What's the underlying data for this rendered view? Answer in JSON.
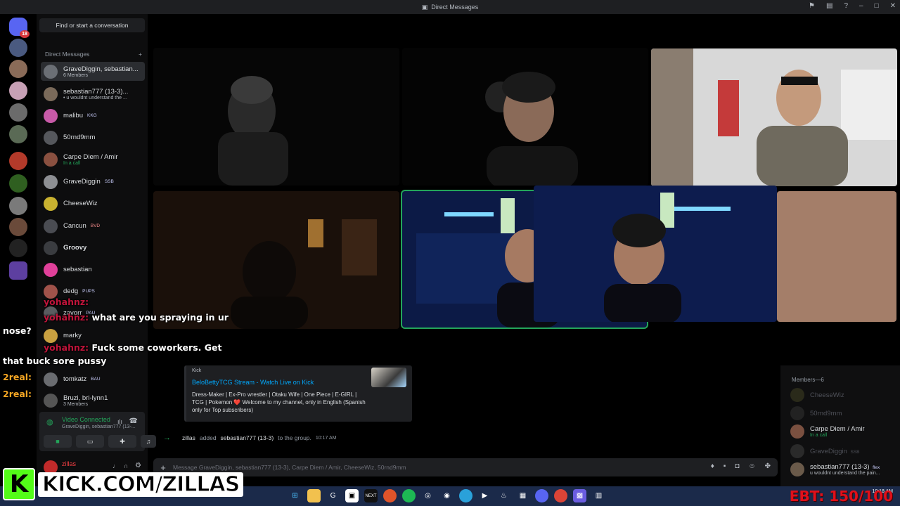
{
  "window": {
    "title": "Direct Messages"
  },
  "rail": {
    "home_badge": "18",
    "dot_badge": "1"
  },
  "sidebar": {
    "search_label": "Find or start a conversation",
    "section_label": "Direct Messages",
    "add_icon": "+",
    "items": [
      {
        "name": "GraveDiggin, sebastian...",
        "sub": "6 Members",
        "tag": ""
      },
      {
        "name": "sebastian777 (13-3)...",
        "sub": "• u wouldnt understand the ...",
        "tag": ""
      },
      {
        "name": "malibu",
        "sub": "",
        "tag": "KKG"
      },
      {
        "name": "50rnd9mm",
        "sub": "",
        "tag": ""
      },
      {
        "name": "Carpe Diem / Amir",
        "sub": "In a call",
        "tag": ""
      },
      {
        "name": "GraveDiggin",
        "sub": "",
        "tag": "SSB"
      },
      {
        "name": "CheeseWiz",
        "sub": "",
        "tag": ""
      },
      {
        "name": "Cancun",
        "sub": "",
        "tag": "BVD"
      },
      {
        "name": "Groovy",
        "sub": "",
        "tag": ""
      },
      {
        "name": "sebastian",
        "sub": "",
        "tag": ""
      },
      {
        "name": "dedg",
        "sub": "",
        "tag": "PUPS"
      },
      {
        "name": "zavorr",
        "sub": "",
        "tag": "PAU"
      },
      {
        "name": "marky",
        "sub": "",
        "tag": ""
      },
      {
        "name": "tomkatz",
        "sub": "",
        "tag": "BAU"
      },
      {
        "name": "Bruzi, bri-lynn1",
        "sub": "3 Members",
        "tag": ""
      }
    ]
  },
  "voice": {
    "status": "Video Connected",
    "channel": "GraveDiggin, sebastian777 (13-..."
  },
  "user_panel": {
    "name": "zillas"
  },
  "overlay": {
    "user1": "yohahnz:",
    "msg1a": "what are you spraying in ur",
    "msg1b": "nose?",
    "user2": "yohahnz:",
    "msg2a": "Fuck some coworkers. Get",
    "msg2b": "that buck sore pussy",
    "tag1": "2real:",
    "tag2": "2real:"
  },
  "embed": {
    "provider": "Kick",
    "title": "BeloBettyTCG Stream - Watch Live on Kick",
    "description": "Dress-Maker | Ex-Pro wrestler | Otaku Wife | One Piece | E-GIRL | TCG | Pokemon ❤️ Welcome to my channel, only in English (Spanish only for Top subscribers)"
  },
  "system_message": {
    "actor": "zillas",
    "action": "added",
    "target": "sebastian777 (13-3)",
    "rest": "to the group.",
    "time": "10:17 AM"
  },
  "composer": {
    "placeholder": "Message GraveDiggin, sebastian777 (13-3), Carpe Diem / Amir, CheeseWiz, 50rnd9mm"
  },
  "members": {
    "header": "Members—6",
    "list": [
      {
        "name": "CheeseWiz",
        "sub": "",
        "dim": true
      },
      {
        "name": "50rnd9mm",
        "sub": "",
        "dim": true
      },
      {
        "name": "Carpe Diem / Amir",
        "sub": "In a call",
        "dim": false
      },
      {
        "name": "GraveDiggin",
        "sub": "",
        "dim": true
      },
      {
        "name": "sebastian777 (13-3)",
        "sub": "u wouldnt understand the pain...",
        "dim": false
      }
    ],
    "flex_tag": "flex",
    "ssb_tag": "SSB"
  },
  "stream": {
    "kick_letter": "K",
    "kick_url": "KICK.COM/ZILLAS",
    "ebt": "EBT: 150/100"
  },
  "taskbar": {
    "time": "10:18 AM"
  },
  "colors": {
    "discord_green": "#23a55a",
    "kick_green": "#53fc18",
    "link_blue": "#00a8fc",
    "overlay_red": "#c1143b",
    "ebt_red": "#e0101a"
  }
}
